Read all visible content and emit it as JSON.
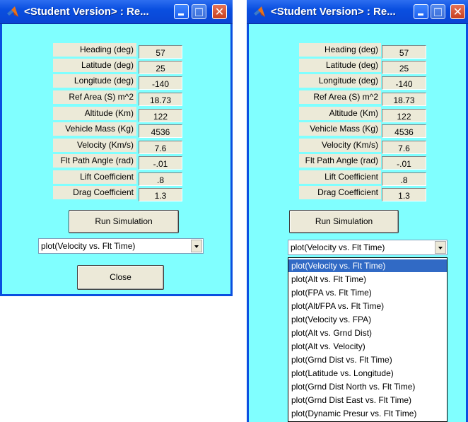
{
  "windows": [
    {
      "title": "<Student Version> : Re...",
      "fields": [
        {
          "label": "Heading (deg)",
          "value": "57"
        },
        {
          "label": "Latitude (deg)",
          "value": "25"
        },
        {
          "label": "Longitude (deg)",
          "value": "-140"
        },
        {
          "label": "Ref Area (S) m^2",
          "value": "18.73"
        },
        {
          "label": "Altitude (Km)",
          "value": "122"
        },
        {
          "label": "Vehicle Mass (Kg)",
          "value": "4536"
        },
        {
          "label": "Velocity (Km/s)",
          "value": "7.6"
        },
        {
          "label": "Flt Path Angle (rad)",
          "value": "-.01"
        },
        {
          "label": "Lift Coefficient",
          "value": ".8"
        },
        {
          "label": "Drag Coefficient",
          "value": "1.3"
        }
      ],
      "run_label": "Run Simulation",
      "plot_selected": "plot(Velocity vs. Flt Time)",
      "close_label": "Close"
    },
    {
      "title": "<Student Version> : Re...",
      "fields": [
        {
          "label": "Heading (deg)",
          "value": "57"
        },
        {
          "label": "Latitude (deg)",
          "value": "25"
        },
        {
          "label": "Longitude (deg)",
          "value": "-140"
        },
        {
          "label": "Ref Area (S) m^2",
          "value": "18.73"
        },
        {
          "label": "Altitude (Km)",
          "value": "122"
        },
        {
          "label": "Vehicle Mass (Kg)",
          "value": "4536"
        },
        {
          "label": "Velocity (Km/s)",
          "value": "7.6"
        },
        {
          "label": "Flt Path Angle (rad)",
          "value": "-.01"
        },
        {
          "label": "Lift Coefficient",
          "value": ".8"
        },
        {
          "label": "Drag Coefficient",
          "value": "1.3"
        }
      ],
      "run_label": "Run Simulation",
      "plot_selected": "plot(Velocity vs. Flt Time)",
      "dropdown_options": [
        "plot(Velocity vs. Flt Time)",
        "plot(Alt vs. Flt Time)",
        "plot(FPA vs. Flt Time)",
        "plot(Alt/FPA vs. Flt Time)",
        "plot(Velocity vs. FPA)",
        "plot(Alt vs. Grnd Dist)",
        "plot(Alt vs. Velocity)",
        "plot(Grnd Dist vs. Flt Time)",
        "plot(Latitude vs. Longitude)",
        "plot(Grnd Dist North vs. Flt Time)",
        "plot(Grnd Dist East vs. Flt Time)",
        "plot(Dynamic Presur vs. Flt Time)"
      ],
      "highlighted_index": 0
    }
  ],
  "icons": {
    "app": "matlab-logo-icon",
    "minimize": "minimize-icon",
    "maximize": "maximize-icon",
    "close": "close-icon",
    "dropdown": "chevron-down-icon"
  },
  "colors": {
    "client_bg": "#80ffff",
    "titlebar": "#0a4fe0",
    "selection": "#316ac5"
  }
}
